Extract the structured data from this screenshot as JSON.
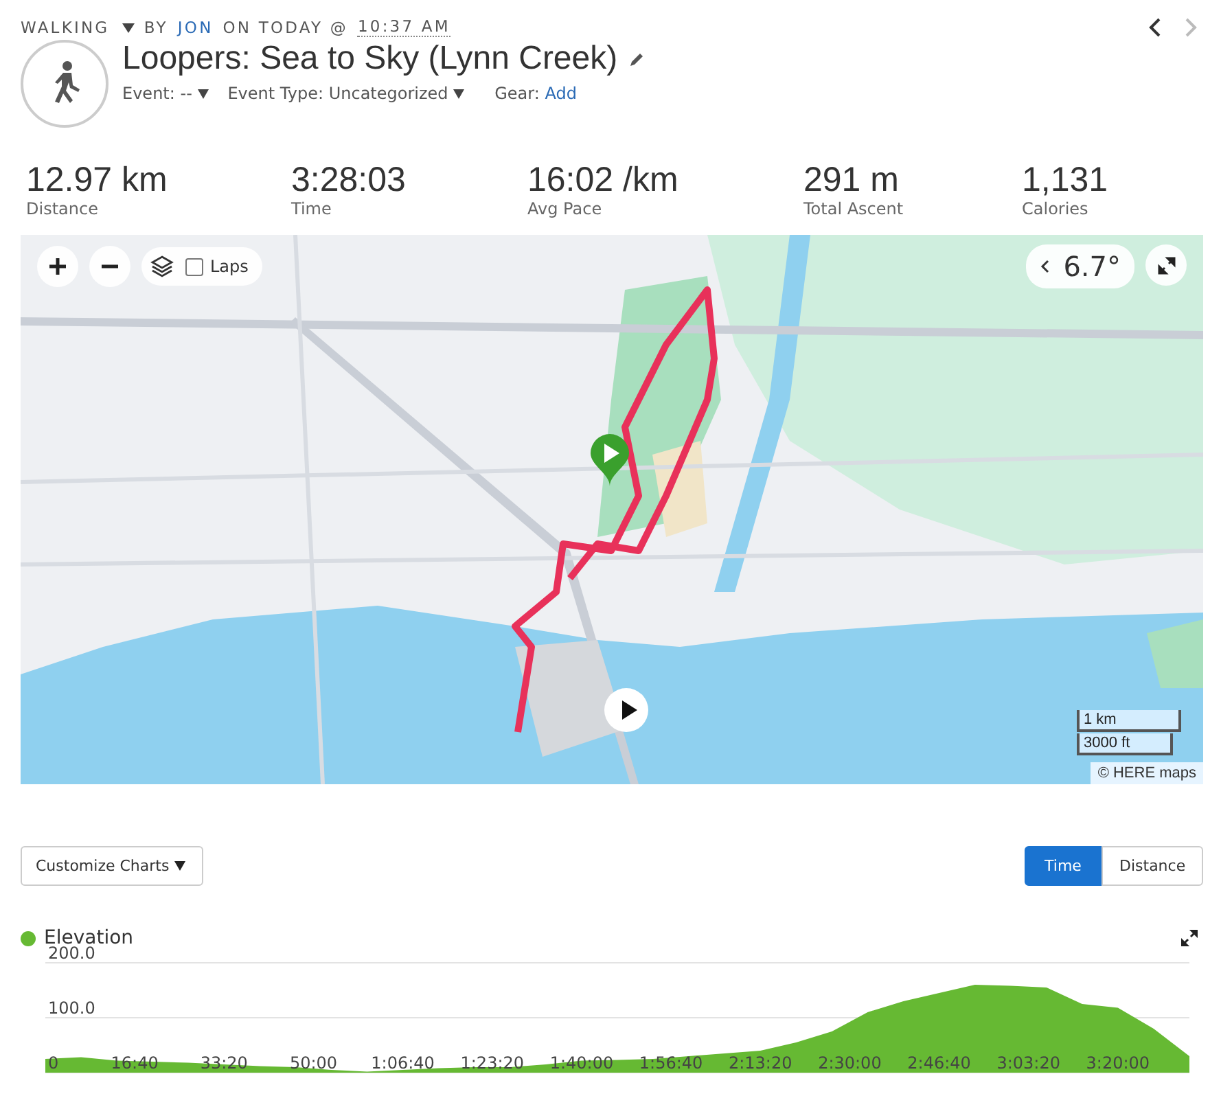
{
  "header": {
    "activity_type": "WALKING",
    "by": "BY",
    "author": "JON",
    "on": "ON TODAY @",
    "time": "10:37 AM",
    "title": "Loopers: Sea to Sky (Lynn Creek)",
    "event_label": "Event:",
    "event_value": "--",
    "event_type_label": "Event Type:",
    "event_type_value": "Uncategorized",
    "gear_label": "Gear:",
    "gear_link": "Add"
  },
  "stats": [
    {
      "value": "12.97 km",
      "label": "Distance"
    },
    {
      "value": "3:28:03",
      "label": "Time"
    },
    {
      "value": "16:02 /km",
      "label": "Avg Pace"
    },
    {
      "value": "291 m",
      "label": "Total Ascent"
    },
    {
      "value": "1,131",
      "label": "Calories"
    }
  ],
  "map": {
    "kind": "picture",
    "laps": {
      "label": "Laps",
      "checked": false
    },
    "temperature": "6.7°",
    "scale": [
      "1 km",
      "3000 ft"
    ],
    "attribution": "© HERE maps"
  },
  "charts": {
    "customize": "Customize Charts",
    "axis_tabs": [
      {
        "label": "Time",
        "selected": true
      },
      {
        "label": "Distance",
        "selected": false
      }
    ],
    "elevation": {
      "chart_data": {
        "type": "area",
        "x": [
          0,
          400,
          800,
          1200,
          1600,
          2000,
          2400,
          2800,
          3200,
          3600,
          4000,
          4400,
          4800,
          5200,
          5600,
          6000,
          6400,
          6800,
          7200,
          7600,
          8000,
          8400,
          8800,
          9200,
          9600,
          10000,
          10400,
          10800,
          11200,
          11600,
          12000,
          12400,
          12800
        ],
        "series": [
          {
            "name": "Elevation",
            "color": "#66b933",
            "values": [
              25,
              28,
              22,
              20,
              18,
              15,
              12,
              10,
              5,
              2,
              5,
              8,
              10,
              10,
              15,
              22,
              23,
              25,
              30,
              35,
              40,
              55,
              75,
              110,
              130,
              145,
              160,
              158,
              155,
              125,
              118,
              80,
              30
            ]
          }
        ],
        "xlim": [
          0,
          12800
        ],
        "ylim": [
          0,
          200
        ],
        "xticks": [
          {
            "value": 1000,
            "label": "16:40"
          },
          {
            "value": 2000,
            "label": "33:20"
          },
          {
            "value": 3000,
            "label": "50:00"
          },
          {
            "value": 4000,
            "label": "1:06:40"
          },
          {
            "value": 5000,
            "label": "1:23:20"
          },
          {
            "value": 6000,
            "label": "1:40:00"
          },
          {
            "value": 7000,
            "label": "1:56:40"
          },
          {
            "value": 8000,
            "label": "2:13:20"
          },
          {
            "value": 9000,
            "label": "2:30:00"
          },
          {
            "value": 10000,
            "label": "2:46:40"
          },
          {
            "value": 11000,
            "label": "3:03:20"
          },
          {
            "value": 12000,
            "label": "3:20:00"
          }
        ],
        "yticks": [
          {
            "value": 0,
            "label": "0"
          },
          {
            "value": 100,
            "label": "100.0"
          },
          {
            "value": 200,
            "label": "200.0"
          }
        ]
      }
    }
  }
}
